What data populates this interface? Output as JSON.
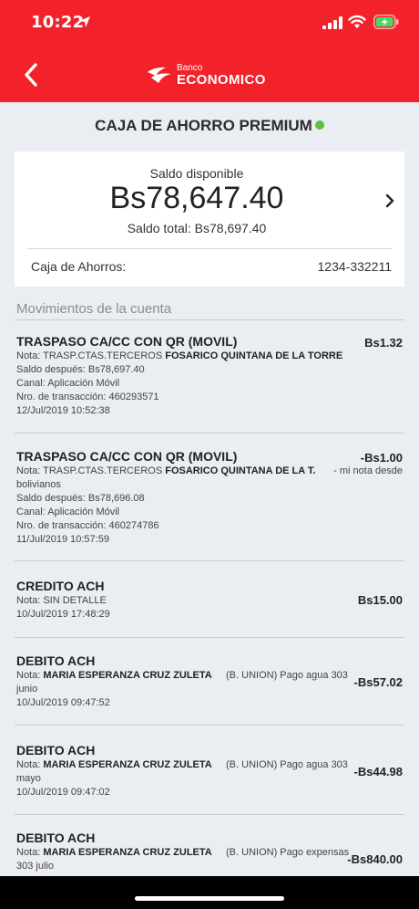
{
  "status_bar": {
    "time": "10:22"
  },
  "header": {
    "logo_small": "Banco",
    "logo_big": "ECONOMICO"
  },
  "account": {
    "title": "CAJA DE AHORRO PREMIUM",
    "available_label": "Saldo disponible",
    "available_amount": "Bs78,647.40",
    "total_label": "Saldo total: Bs78,697.40",
    "type_label": "Caja de Ahorros:",
    "number": "1234-332211"
  },
  "movements": {
    "header": "Movimientos de la cuenta",
    "items": [
      {
        "title": "TRASPASO CA/CC CON QR (MOVIL)",
        "amount": "Bs1.32",
        "note_prefix": "Nota: TRASP.CTAS.TERCEROS",
        "note_name": "FOSARICO QUINTANA DE LA TORRE",
        "note_extra": "",
        "note_cont": "",
        "balance_after": "Saldo después: Bs78,697.40",
        "channel": "Canal: Aplicación Móvil",
        "tx_number": "Nro. de transacción: 460293571",
        "datetime": "12/Jul/2019 10:52:38"
      },
      {
        "title": "TRASPASO CA/CC CON QR (MOVIL)",
        "amount": "-Bs1.00",
        "note_prefix": "Nota: TRASP.CTAS.TERCEROS",
        "note_name": "FOSARICO QUINTANA DE LA T.",
        "note_extra": "- mi nota desde",
        "note_cont": "bolivianos",
        "balance_after": "Saldo después: Bs78,696.08",
        "channel": "Canal: Aplicación Móvil",
        "tx_number": "Nro. de transacción: 460274786",
        "datetime": "11/Jul/2019 10:57:59"
      },
      {
        "title": "CREDITO ACH",
        "amount": "Bs15.00",
        "note": "Nota: SIN DETALLE",
        "datetime": "10/Jul/2019 17:48:29"
      },
      {
        "title": "DEBITO ACH",
        "amount": "-Bs57.02",
        "note_prefix": "Nota:",
        "note_name": "MARIA ESPERANZA CRUZ ZULETA",
        "note_extra": "(B. UNION) Pago agua 303",
        "note_cont": "junio",
        "datetime": "10/Jul/2019 09:47:52"
      },
      {
        "title": "DEBITO ACH",
        "amount": "-Bs44.98",
        "note_prefix": "Nota:",
        "note_name": "MARIA ESPERANZA CRUZ ZULETA",
        "note_extra": "(B. UNION) Pago agua 303",
        "note_cont": "mayo",
        "datetime": "10/Jul/2019 09:47:02"
      },
      {
        "title": "DEBITO ACH",
        "amount": "-Bs840.00",
        "note_prefix": "Nota:",
        "note_name": "MARIA ESPERANZA CRUZ ZULETA",
        "note_extra": "(B. UNION) Pago expensas",
        "note_cont": "303 julio"
      }
    ]
  },
  "colors": {
    "brand_red": "#f3222a",
    "status_green": "#5dc23a",
    "background": "#eaedf2"
  }
}
